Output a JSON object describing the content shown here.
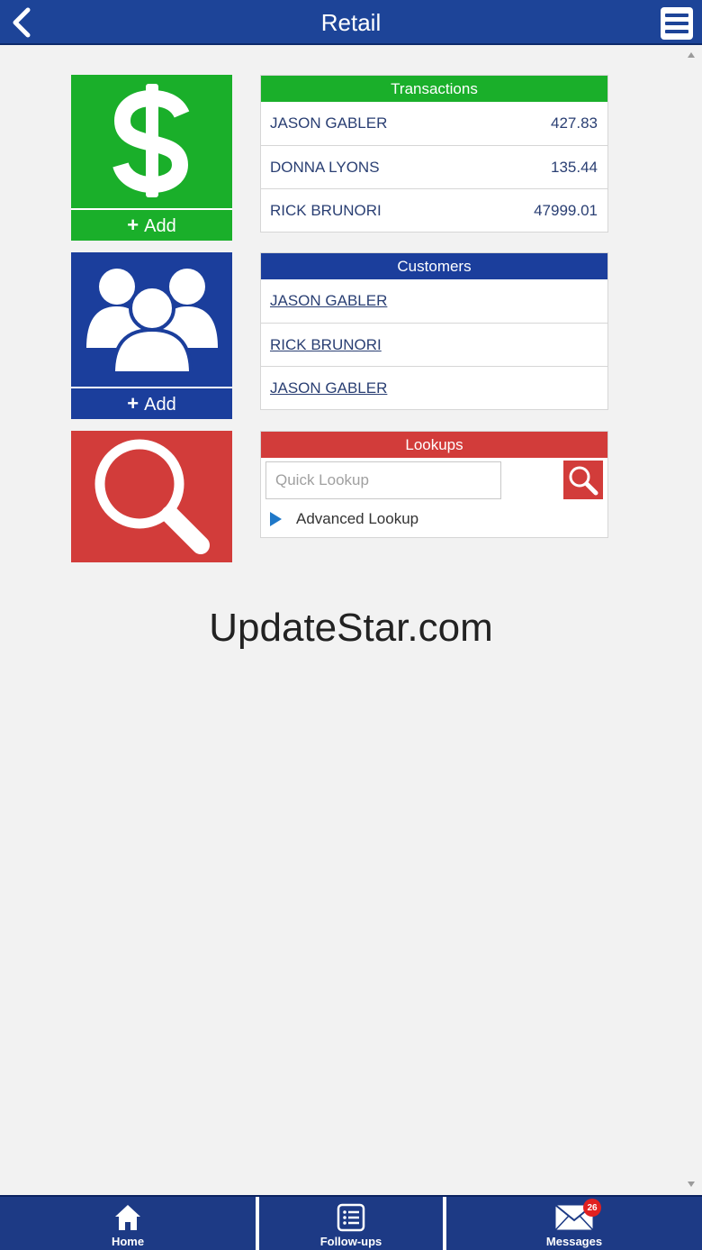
{
  "header": {
    "title": "Retail"
  },
  "tiles": {
    "transactions_add": "Add",
    "customers_add": "Add"
  },
  "transactions": {
    "title": "Transactions",
    "rows": [
      {
        "name": "JASON GABLER",
        "amount": "427.83"
      },
      {
        "name": "DONNA LYONS",
        "amount": "135.44"
      },
      {
        "name": "RICK BRUNORI",
        "amount": "47999.01"
      }
    ]
  },
  "customers": {
    "title": "Customers",
    "rows": [
      {
        "name": "JASON GABLER"
      },
      {
        "name": "RICK BRUNORI"
      },
      {
        "name": "JASON GABLER"
      }
    ]
  },
  "lookups": {
    "title": "Lookups",
    "placeholder": "Quick Lookup",
    "value": "",
    "advanced_label": "Advanced Lookup"
  },
  "watermark": "UpdateStar.com",
  "nav": {
    "home_label": "Home",
    "followups_label": "Follow-ups",
    "messages_label": "Messages",
    "messages_count": "26"
  },
  "colors": {
    "header": "#1d4498",
    "green": "#1aaf2a",
    "blue": "#1b3e9c",
    "red": "#d23c3a",
    "nav": "#1d3a85"
  },
  "icons": {
    "back": "chevron-left-icon",
    "menu": "hamburger-icon",
    "transactions": "dollar-icon",
    "customers": "people-icon",
    "lookups": "magnifier-icon",
    "home": "home-icon",
    "followups": "checklist-icon",
    "messages": "envelope-icon"
  }
}
